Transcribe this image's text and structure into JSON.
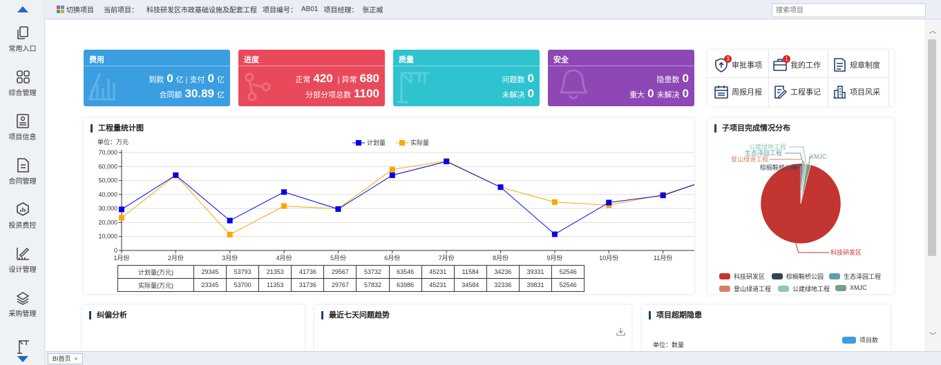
{
  "sidebar": {
    "items": [
      {
        "label": "常用入口",
        "icon": "copy-icon"
      },
      {
        "label": "综合管理",
        "icon": "grid-icon"
      },
      {
        "label": "项目信息",
        "icon": "profile-icon"
      },
      {
        "label": "合同管理",
        "icon": "document-icon"
      },
      {
        "label": "投资费控",
        "icon": "investment-chart-icon"
      },
      {
        "label": "设计管理",
        "icon": "ruler-pencil-icon"
      },
      {
        "label": "采购管理",
        "icon": "stack-icon"
      },
      {
        "label": "",
        "icon": "crane-icon"
      }
    ]
  },
  "topbar": {
    "switch_label": "切换项目",
    "project_label": "当前项目：",
    "project_name": "科技研发区市政基础设施及配套工程",
    "code_label": "项目编号：",
    "code_value": "AB01",
    "manager_label": "项目经理：",
    "manager_value": "张正威",
    "search_placeholder": "搜索项目"
  },
  "cards": {
    "cost": {
      "title": "费用",
      "l1a": "到款",
      "v1a": "0",
      "u1a": "亿",
      "sep": "|",
      "l1b": "支付",
      "v1b": "0",
      "u1b": "亿",
      "l2": "合同额",
      "v2": "30.89",
      "u2": "亿",
      "color": "#3a9ee0"
    },
    "progress": {
      "title": "进度",
      "l1a": "正常",
      "v1a": "420",
      "sep": "|",
      "l1b": "异常",
      "v1b": "680",
      "l2": "分部分项总数",
      "v2": "1100",
      "color": "#e84a5b"
    },
    "quality": {
      "title": "质量",
      "l1": "问题数",
      "v1": "0",
      "l2": "未解决",
      "v2": "0",
      "color": "#2fc3d0"
    },
    "safety": {
      "title": "安全",
      "l1": "隐患数",
      "v1": "0",
      "l2a": "重大",
      "v2a": "0",
      "l2b": "未解决",
      "v2b": "0",
      "color": "#8e47b5"
    }
  },
  "quicklinks": [
    {
      "label": "审批事项",
      "badge": "3",
      "icon": "shield-approve-icon"
    },
    {
      "label": "我的工作",
      "badge": "1",
      "icon": "briefcase-icon"
    },
    {
      "label": "规章制度",
      "badge": "",
      "icon": "rules-document-icon"
    },
    {
      "label": "周报月报",
      "badge": "",
      "icon": "calendar-icon"
    },
    {
      "label": "工程事记",
      "badge": "",
      "icon": "edit-note-icon"
    },
    {
      "label": "项目风采",
      "badge": "",
      "icon": "buildings-icon"
    }
  ],
  "line_panel": {
    "title": "工程量统计图",
    "unit": "单位：万元"
  },
  "pie_panel": {
    "title": "子项目完成情况分布"
  },
  "bottom_panels": {
    "p1": {
      "title": "纠偏分析"
    },
    "p2": {
      "title": "最近七天问题趋势"
    },
    "p3": {
      "title": "项目超期隐患",
      "unit": "单位：数量",
      "legend": "项目数"
    }
  },
  "tabs": [
    {
      "label": "BI首页",
      "close": "×"
    }
  ],
  "chart_data": [
    {
      "type": "line",
      "title": "工程量统计图",
      "ylabel": "单位：万元",
      "ylim": [
        0,
        70000
      ],
      "yticks": [
        "0",
        "10,000",
        "20,000",
        "30,000",
        "40,000",
        "50,000",
        "60,000",
        "70,000"
      ],
      "categories": [
        "1月份",
        "2月份",
        "3月份",
        "4月份",
        "5月份",
        "6月份",
        "7月份",
        "8月份",
        "9月份",
        "10月份",
        "11月份",
        "12月份"
      ],
      "series": [
        {
          "name": "计划量",
          "color": "#0000ee",
          "values": [
            29345,
            53793,
            21353,
            41736,
            29567,
            53732,
            63546,
            45231,
            11584,
            34236,
            39331,
            52546
          ]
        },
        {
          "name": "实际量",
          "color": "#ffa500",
          "values": [
            23345,
            53700,
            11353,
            31736,
            29767,
            57832,
            63986,
            45231,
            34584,
            32336,
            39831,
            52546
          ]
        }
      ],
      "table_rows": [
        {
          "label": "计划量(万元)",
          "values": [
            "29345",
            "53793",
            "21353",
            "41736",
            "29567",
            "53732",
            "63546",
            "45231",
            "11584",
            "34236",
            "39331",
            "52546"
          ]
        },
        {
          "label": "实际量(万元)",
          "values": [
            "23345",
            "53700",
            "11353",
            "31736",
            "29767",
            "57832",
            "63986",
            "45231",
            "34584",
            "32336",
            "39831",
            "52546"
          ]
        }
      ],
      "legend_position": "top-center",
      "grid": true
    },
    {
      "type": "pie",
      "title": "子项目完成情况分布",
      "slices": [
        {
          "name": "科技研发区",
          "value": 96,
          "color": "#c23531"
        },
        {
          "name": "棕榈鞍桥公园",
          "value": 0.6,
          "color": "#2f4554"
        },
        {
          "name": "生态泽园工程",
          "value": 0.6,
          "color": "#61a0a8"
        },
        {
          "name": "登山绿道工程",
          "value": 0.6,
          "color": "#d48265"
        },
        {
          "name": "公建绿地工程",
          "value": 0.6,
          "color": "#91c7ae"
        },
        {
          "name": "XMJC",
          "value": 1.6,
          "color": "#749f83"
        }
      ],
      "legend_position": "bottom"
    }
  ]
}
